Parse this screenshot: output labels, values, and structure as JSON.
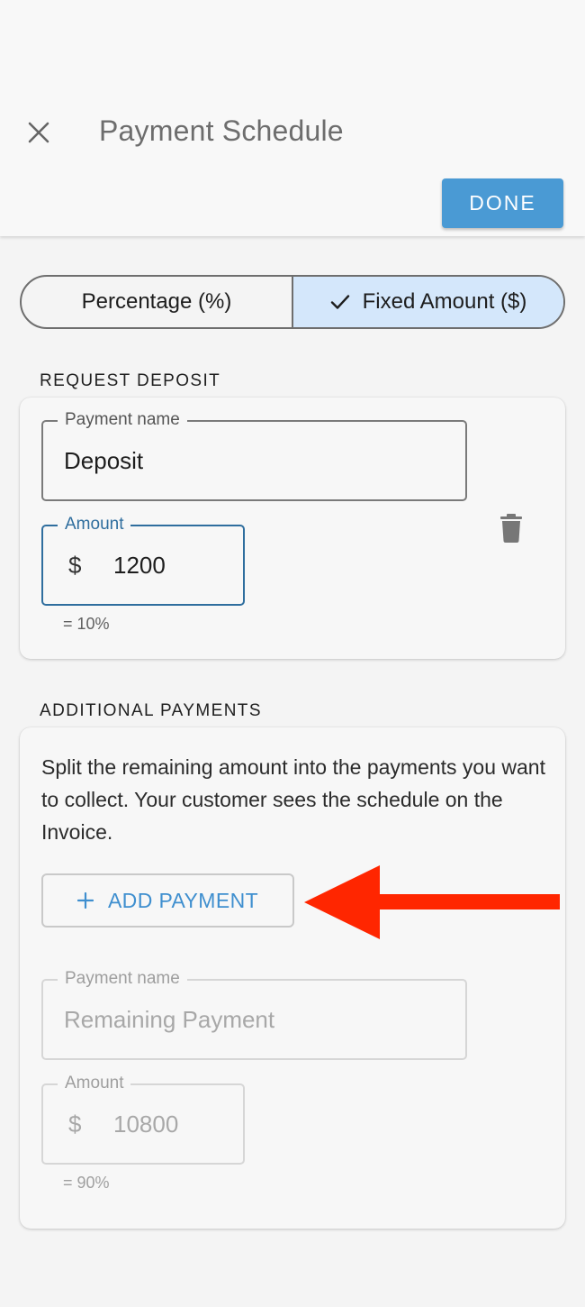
{
  "header": {
    "title": "Payment Schedule",
    "close_icon": "close-icon",
    "done_label": "DONE"
  },
  "mode_toggle": {
    "options": [
      {
        "label": "Percentage (%)",
        "selected": false
      },
      {
        "label": "Fixed Amount ($)",
        "selected": true
      }
    ]
  },
  "deposit": {
    "heading": "REQUEST DEPOSIT",
    "name_label": "Payment name",
    "name_value": "Deposit",
    "amount_label": "Amount",
    "currency_symbol": "$",
    "amount_value": "1200",
    "percent_helper": "= 10%",
    "delete_icon": "trash-icon"
  },
  "additional": {
    "heading": "ADDITIONAL PAYMENTS",
    "description": "Split the remaining amount into the payments you want to collect. Your customer sees the schedule on the Invoice.",
    "add_button_label": "ADD PAYMENT",
    "remaining": {
      "name_label": "Payment name",
      "name_value": "Remaining Payment",
      "amount_label": "Amount",
      "currency_symbol": "$",
      "amount_value": "10800",
      "percent_helper": "= 90%"
    }
  },
  "colors": {
    "accent": "#4a9ad4",
    "selected_segment": "#d4e7fb",
    "focused_field": "#2f6e9e",
    "annotation_arrow": "#ff2600"
  }
}
